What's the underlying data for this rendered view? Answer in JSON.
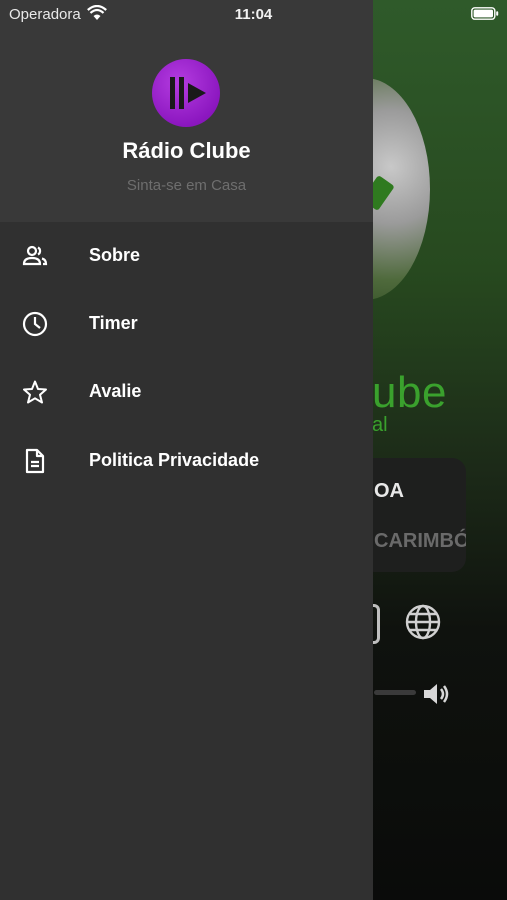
{
  "status_bar": {
    "carrier": "Operadora",
    "time": "11:04"
  },
  "drawer": {
    "app_name": "Rádio Clube",
    "tagline": "Sinta-se em Casa",
    "logo_color": "#8c17c0",
    "menu": [
      {
        "label": "Sobre",
        "icon": "people-icon"
      },
      {
        "label": "Timer",
        "icon": "clock-icon"
      },
      {
        "label": "Avalie",
        "icon": "star-icon"
      },
      {
        "label": "Politica Privacidade",
        "icon": "document-icon"
      }
    ]
  },
  "background_app": {
    "title_fragment": "ube",
    "subtitle_fragment": "al",
    "now_playing_line1": "OA",
    "now_playing_line2": "CARIMBÓ",
    "accent_color": "#3aa12d"
  }
}
